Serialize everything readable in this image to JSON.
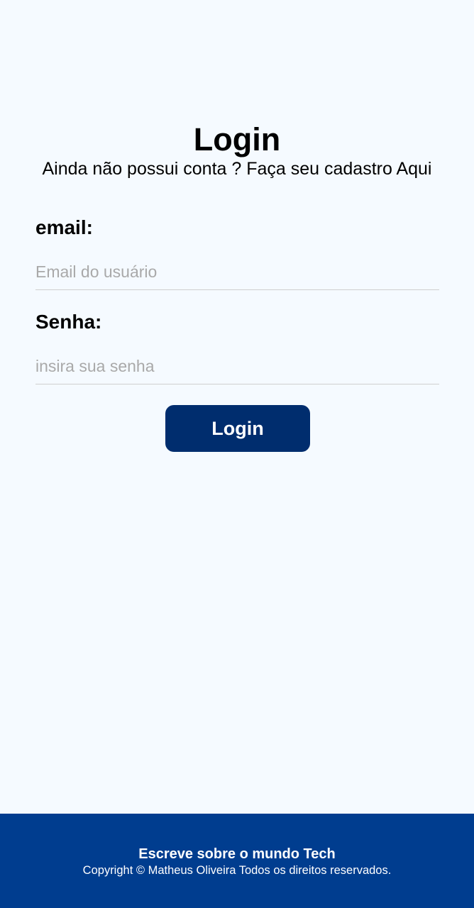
{
  "login": {
    "title": "Login",
    "subtitle": "Ainda não possui conta ? Faça seu cadastro Aqui",
    "email_label": "email:",
    "email_placeholder": "Email do usuário",
    "password_label": "Senha:",
    "password_placeholder": "insira sua senha",
    "submit_label": "Login"
  },
  "footer": {
    "title": "Escreve sobre o mundo Tech",
    "copyright": "Copyright © Matheus Oliveira Todos os direitos reservados."
  },
  "colors": {
    "background": "#f5faff",
    "button": "#002d6e",
    "footer": "#003d8f"
  }
}
